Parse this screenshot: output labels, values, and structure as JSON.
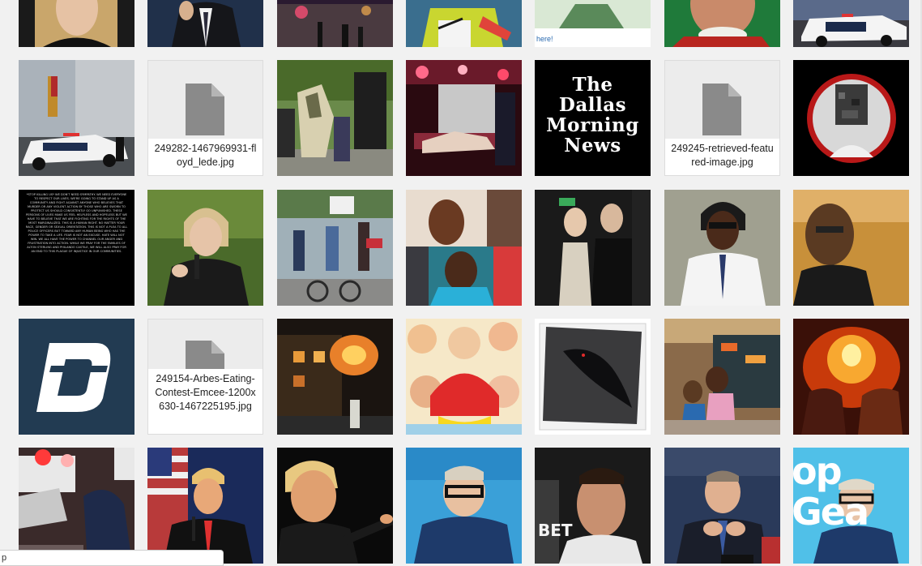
{
  "media_library": {
    "file_tiles": [
      {
        "name": "249282-1467969931-floyd_lede.jpg"
      },
      {
        "name": "249245-retrieved-featured-image.jpg"
      },
      {
        "name": "249154-Arbes-Eating-Contest-Emcee-1200x630-1467225195.jpg"
      }
    ],
    "captions": {
      "partial_caption": "here!",
      "dmn_logo_text": "The\nDallas\nMorning\nNews",
      "statement_text": "*STOP KILLING US* WE DON'T NEED SYMPATHY. WE NEED EVERYONE TO RESPECT OUR LIVES. WE'RE GOING TO STAND UP AS A COMMUNITY AND FIGHT AGAINST ANYONE WHO BELIEVES THAT MURDER OR ANY VIOLENT ACTION BY THOSE WHO ARE SWORN TO PROTECT US SHOULD CONSISTENTLY GO UNPUNISHED. THESE PERSONS OF LIVES MAKE US FEEL HELPLESS AND HOPELESS BUT WE HAVE TO BELIEVE THAT WE ARE FIGHTING FOR THE RIGHTS OF THE MOST MARGINALIZED. THIS IS A HUMAN RIGHT. NO MATTER YOUR RACE, GENDER OR SEXUAL ORIENTATION. THIS IS NOT A PLEA TO ALL POLICE OFFICERS BUT TOWARD ANY HUMAN BEING WHO HAS THE POWER TO TAKE A LIFE. FEAR IS NOT AN EXCUSE. HATE WILL NOT WIN. WE ALL HAVE THE POWER TO CHANNEL OUR ANGER AND FRUSTRATION INTO ACTION. WHILE WE PRAY FOR THE FAMILIES OF ALTON STERLING AND PHILANDO CASTILE, WE WILL ALSO PRAY FOR AN END TO THIS PLAGUE OF INJUSTICE IN OUR COMMUNITIES.",
      "topgear_text": "op Gea",
      "bet_text": "BET"
    },
    "status_bar": {
      "url_text": "p"
    },
    "colors": {
      "background": "#f1f1f1",
      "file_tile_bg": "#ececec",
      "file_icon": "#8a8a8a",
      "dallas_blue": "#223b52"
    }
  }
}
